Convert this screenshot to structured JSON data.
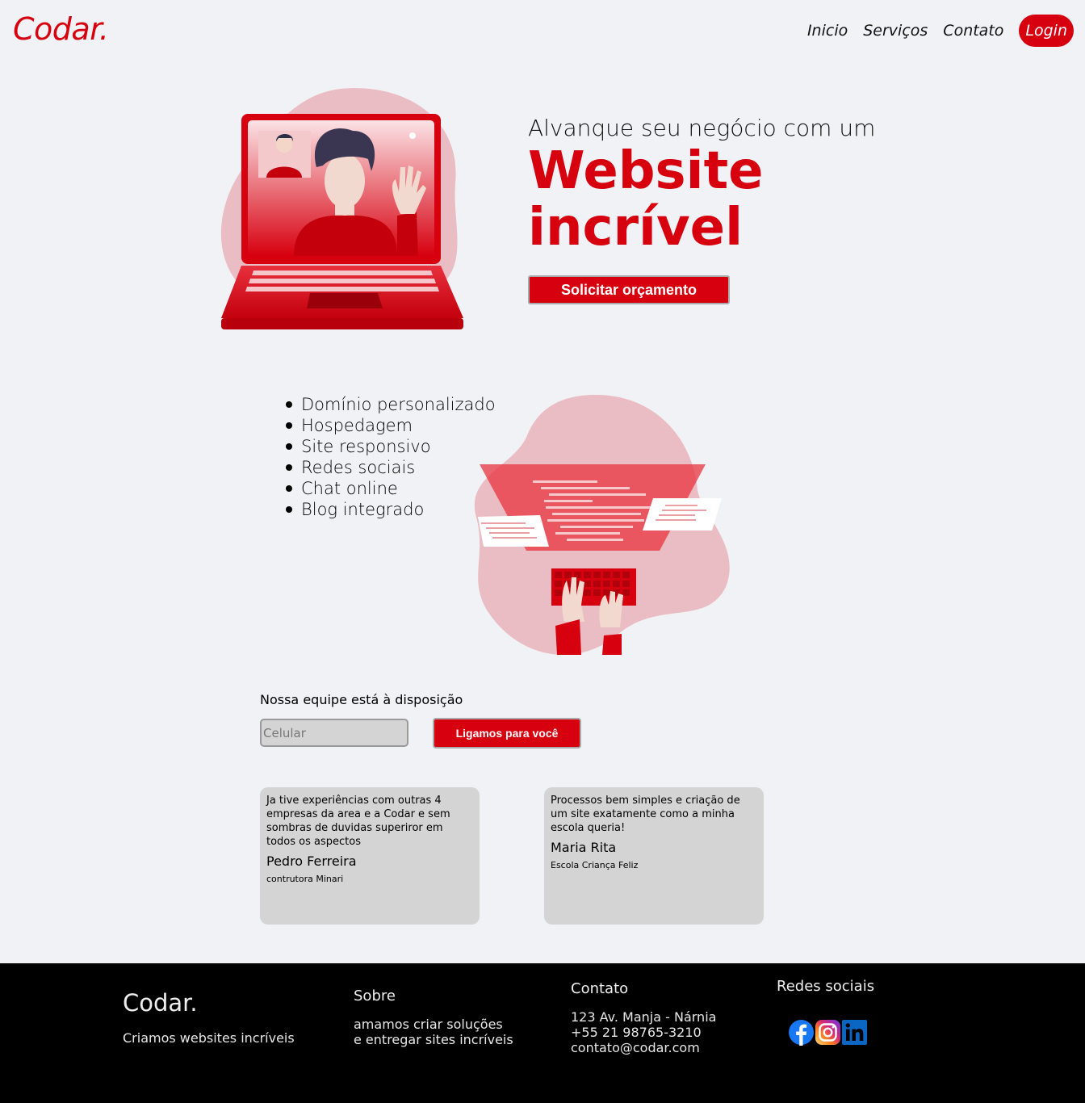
{
  "header": {
    "logo": "Codar.",
    "nav": [
      {
        "label": "Inicio"
      },
      {
        "label": "Serviços"
      },
      {
        "label": "Contato"
      }
    ],
    "login_label": "Login"
  },
  "hero": {
    "subtitle": "Alvanque seu negócio com um",
    "title_line1": "Website",
    "title_line2": "incrível",
    "cta_label": "Solicitar orçamento"
  },
  "features": [
    "Domínio personalizado",
    "Hospedagem",
    "Site responsivo",
    "Redes sociais",
    "Chat online",
    "Blog integrado"
  ],
  "contact_form": {
    "label": "Nossa equipe está à disposição",
    "phone_placeholder": "Celular",
    "button_label": "Ligamos para você"
  },
  "testimonials": [
    {
      "quote": "Ja tive experiências com outras 4 empresas da area e a Codar e sem sombras de duvidas superiror em todos os aspectos",
      "name": "Pedro Ferreira",
      "company": "contrutora Minari"
    },
    {
      "quote": "Processos bem simples e criação de um site exatamente como a minha escola queria!",
      "name": "Maria Rita",
      "company": "Escola Criança Feliz"
    }
  ],
  "footer": {
    "logo": "Codar.",
    "tagline": "Criamos websites incríveis",
    "about_heading": "Sobre",
    "about_line1": "amamos criar soluções",
    "about_line2": "e entregar sites incríveis",
    "contact_heading": "Contato",
    "address": "123 Av. Manja - Nárnia",
    "phone": "+55 21 98765-3210",
    "email": "contato@codar.com",
    "social_heading": "Redes sociais",
    "social_icons": [
      "facebook-icon",
      "instagram-icon",
      "linkedin-icon"
    ]
  },
  "colors": {
    "brand": "#d7000f",
    "background": "#f0f2f5",
    "card": "#d4d4d4",
    "footer": "#000000"
  }
}
